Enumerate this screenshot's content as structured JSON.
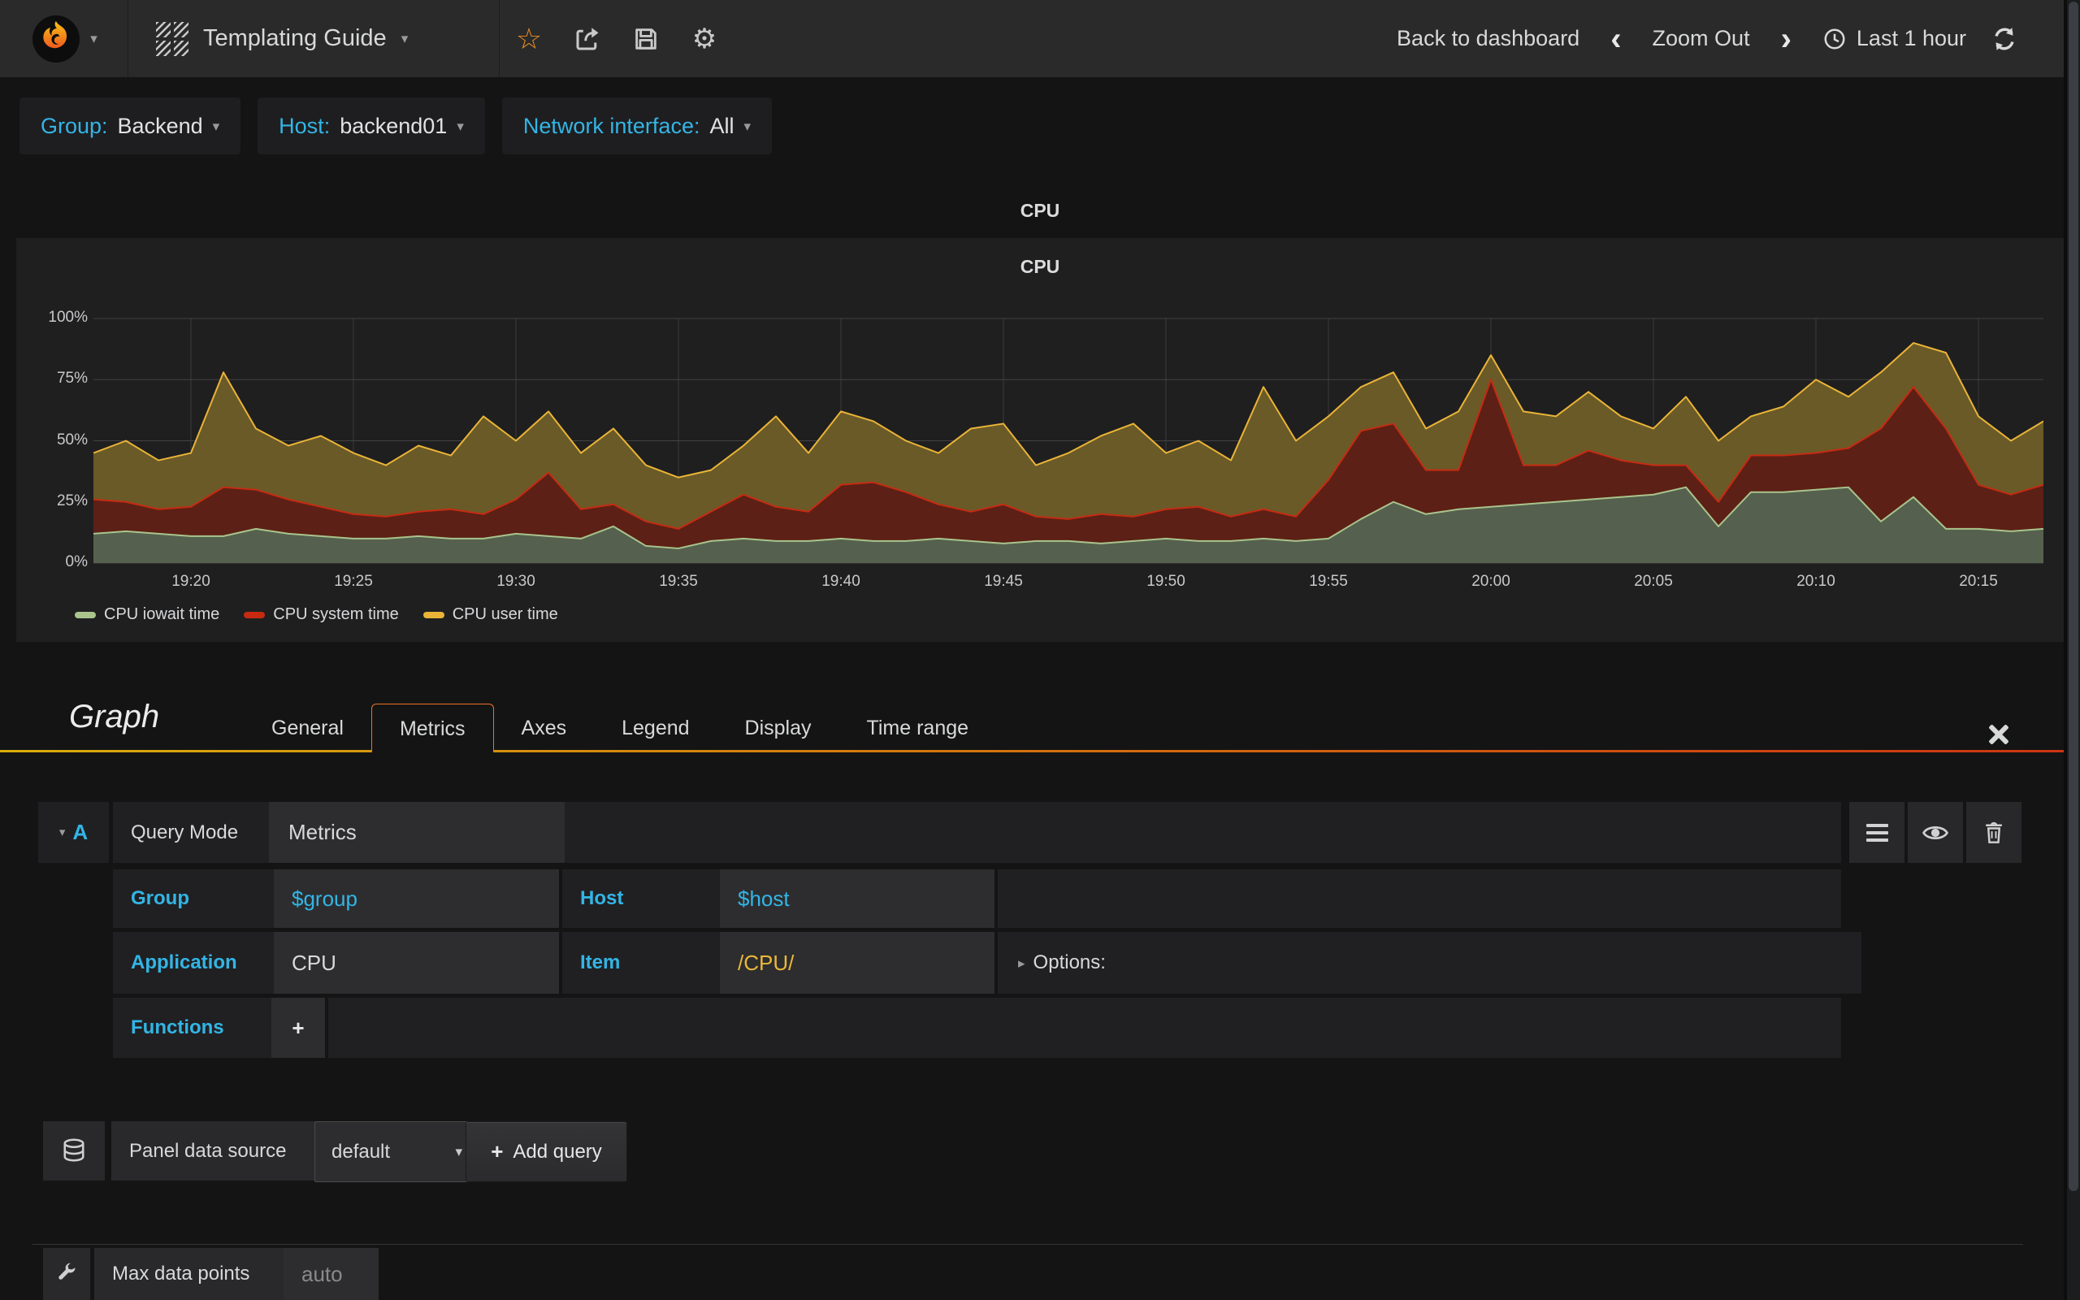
{
  "icons": {
    "caret_down": "▾",
    "caret_right": "▸",
    "plus": "+",
    "star": "☆",
    "gear": "⚙",
    "chev_left": "‹",
    "chev_right": "›"
  },
  "navbar": {
    "title": "Templating Guide",
    "back": "Back to dashboard",
    "zoom_out": "Zoom Out",
    "time": "Last 1 hour"
  },
  "variables": [
    {
      "label": "Group:",
      "value": "Backend"
    },
    {
      "label": "Host:",
      "value": "backend01"
    },
    {
      "label": "Network interface:",
      "value": "All"
    }
  ],
  "panel": {
    "outer_title": "CPU",
    "title": "CPU"
  },
  "chart_data": {
    "type": "area",
    "stacked": true,
    "title": "CPU",
    "unit": "percent",
    "ylim": [
      0,
      100
    ],
    "grid": true,
    "legend_position": "bottom",
    "y_ticks": [
      "0%",
      "25%",
      "50%",
      "75%",
      "100%"
    ],
    "x_ticks": [
      "19:20",
      "19:25",
      "19:30",
      "19:35",
      "19:40",
      "19:45",
      "19:50",
      "19:55",
      "20:00",
      "20:05",
      "20:10",
      "20:15"
    ],
    "x_start": "19:17",
    "x_end": "20:17",
    "interval_minutes": 1,
    "series": [
      {
        "name": "CPU iowait time",
        "color": "#A9C48C",
        "fill": "#55614E",
        "values": [
          12,
          13,
          12,
          11,
          11,
          14,
          12,
          11,
          10,
          10,
          11,
          10,
          10,
          12,
          11,
          10,
          15,
          7,
          6,
          9,
          10,
          9,
          9,
          10,
          9,
          9,
          10,
          9,
          8,
          9,
          9,
          8,
          9,
          10,
          9,
          9,
          10,
          9,
          10,
          18,
          25,
          20,
          22,
          23,
          24,
          25,
          26,
          27,
          28,
          31,
          15,
          29,
          29,
          30,
          31,
          17,
          27,
          14,
          14,
          13,
          14
        ]
      },
      {
        "name": "CPU system time",
        "color": "#C62B12",
        "fill": "#5C2016",
        "values": [
          14,
          12,
          10,
          12,
          20,
          16,
          14,
          12,
          10,
          9,
          10,
          12,
          10,
          14,
          26,
          12,
          9,
          10,
          8,
          12,
          18,
          14,
          12,
          22,
          24,
          20,
          14,
          12,
          16,
          10,
          9,
          12,
          10,
          12,
          14,
          10,
          12,
          10,
          24,
          36,
          32,
          18,
          16,
          52,
          16,
          15,
          20,
          15,
          12,
          9,
          10,
          15,
          15,
          15,
          16,
          38,
          45,
          41,
          18,
          15,
          18
        ]
      },
      {
        "name": "CPU user time",
        "color": "#EAB437",
        "fill": "#6A5A28",
        "values": [
          19,
          25,
          20,
          22,
          47,
          25,
          22,
          29,
          25,
          21,
          27,
          22,
          40,
          24,
          25,
          23,
          31,
          23,
          21,
          17,
          20,
          37,
          24,
          30,
          25,
          21,
          21,
          34,
          33,
          21,
          27,
          32,
          38,
          23,
          27,
          23,
          50,
          31,
          26,
          18,
          21,
          17,
          24,
          10,
          22,
          20,
          24,
          18,
          15,
          28,
          25,
          16,
          20,
          30,
          21,
          23,
          18,
          31,
          28,
          22,
          26
        ]
      }
    ]
  },
  "editor": {
    "heading": "Graph",
    "tabs": [
      "General",
      "Metrics",
      "Axes",
      "Legend",
      "Display",
      "Time range"
    ],
    "active_tab": "Metrics"
  },
  "query": {
    "ref": "A",
    "mode_label": "Query Mode",
    "mode_value": "Metrics",
    "group_label": "Group",
    "group_value": "$group",
    "host_label": "Host",
    "host_value": "$host",
    "app_label": "Application",
    "app_value": "CPU",
    "item_label": "Item",
    "item_value": "/CPU/",
    "options_label": "Options:",
    "functions_label": "Functions"
  },
  "datasource": {
    "label": "Panel data source",
    "value": "default",
    "add_query_label": "Add query"
  },
  "footer": {
    "label": "Max data points",
    "placeholder": "auto"
  }
}
